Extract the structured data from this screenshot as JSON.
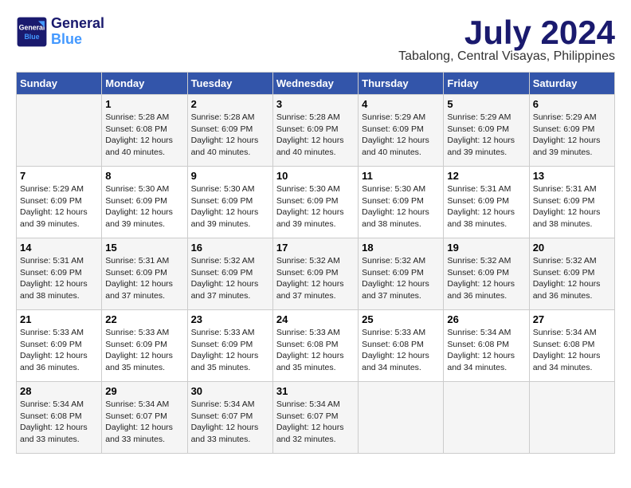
{
  "logo": {
    "line1": "General",
    "line2": "Blue"
  },
  "title": "July 2024",
  "location": "Tabalong, Central Visayas, Philippines",
  "weekdays": [
    "Sunday",
    "Monday",
    "Tuesday",
    "Wednesday",
    "Thursday",
    "Friday",
    "Saturday"
  ],
  "weeks": [
    [
      {
        "day": "",
        "info": ""
      },
      {
        "day": "1",
        "info": "Sunrise: 5:28 AM\nSunset: 6:08 PM\nDaylight: 12 hours\nand 40 minutes."
      },
      {
        "day": "2",
        "info": "Sunrise: 5:28 AM\nSunset: 6:09 PM\nDaylight: 12 hours\nand 40 minutes."
      },
      {
        "day": "3",
        "info": "Sunrise: 5:28 AM\nSunset: 6:09 PM\nDaylight: 12 hours\nand 40 minutes."
      },
      {
        "day": "4",
        "info": "Sunrise: 5:29 AM\nSunset: 6:09 PM\nDaylight: 12 hours\nand 40 minutes."
      },
      {
        "day": "5",
        "info": "Sunrise: 5:29 AM\nSunset: 6:09 PM\nDaylight: 12 hours\nand 39 minutes."
      },
      {
        "day": "6",
        "info": "Sunrise: 5:29 AM\nSunset: 6:09 PM\nDaylight: 12 hours\nand 39 minutes."
      }
    ],
    [
      {
        "day": "7",
        "info": "Sunrise: 5:29 AM\nSunset: 6:09 PM\nDaylight: 12 hours\nand 39 minutes."
      },
      {
        "day": "8",
        "info": "Sunrise: 5:30 AM\nSunset: 6:09 PM\nDaylight: 12 hours\nand 39 minutes."
      },
      {
        "day": "9",
        "info": "Sunrise: 5:30 AM\nSunset: 6:09 PM\nDaylight: 12 hours\nand 39 minutes."
      },
      {
        "day": "10",
        "info": "Sunrise: 5:30 AM\nSunset: 6:09 PM\nDaylight: 12 hours\nand 39 minutes."
      },
      {
        "day": "11",
        "info": "Sunrise: 5:30 AM\nSunset: 6:09 PM\nDaylight: 12 hours\nand 38 minutes."
      },
      {
        "day": "12",
        "info": "Sunrise: 5:31 AM\nSunset: 6:09 PM\nDaylight: 12 hours\nand 38 minutes."
      },
      {
        "day": "13",
        "info": "Sunrise: 5:31 AM\nSunset: 6:09 PM\nDaylight: 12 hours\nand 38 minutes."
      }
    ],
    [
      {
        "day": "14",
        "info": "Sunrise: 5:31 AM\nSunset: 6:09 PM\nDaylight: 12 hours\nand 38 minutes."
      },
      {
        "day": "15",
        "info": "Sunrise: 5:31 AM\nSunset: 6:09 PM\nDaylight: 12 hours\nand 37 minutes."
      },
      {
        "day": "16",
        "info": "Sunrise: 5:32 AM\nSunset: 6:09 PM\nDaylight: 12 hours\nand 37 minutes."
      },
      {
        "day": "17",
        "info": "Sunrise: 5:32 AM\nSunset: 6:09 PM\nDaylight: 12 hours\nand 37 minutes."
      },
      {
        "day": "18",
        "info": "Sunrise: 5:32 AM\nSunset: 6:09 PM\nDaylight: 12 hours\nand 37 minutes."
      },
      {
        "day": "19",
        "info": "Sunrise: 5:32 AM\nSunset: 6:09 PM\nDaylight: 12 hours\nand 36 minutes."
      },
      {
        "day": "20",
        "info": "Sunrise: 5:32 AM\nSunset: 6:09 PM\nDaylight: 12 hours\nand 36 minutes."
      }
    ],
    [
      {
        "day": "21",
        "info": "Sunrise: 5:33 AM\nSunset: 6:09 PM\nDaylight: 12 hours\nand 36 minutes."
      },
      {
        "day": "22",
        "info": "Sunrise: 5:33 AM\nSunset: 6:09 PM\nDaylight: 12 hours\nand 35 minutes."
      },
      {
        "day": "23",
        "info": "Sunrise: 5:33 AM\nSunset: 6:09 PM\nDaylight: 12 hours\nand 35 minutes."
      },
      {
        "day": "24",
        "info": "Sunrise: 5:33 AM\nSunset: 6:08 PM\nDaylight: 12 hours\nand 35 minutes."
      },
      {
        "day": "25",
        "info": "Sunrise: 5:33 AM\nSunset: 6:08 PM\nDaylight: 12 hours\nand 34 minutes."
      },
      {
        "day": "26",
        "info": "Sunrise: 5:34 AM\nSunset: 6:08 PM\nDaylight: 12 hours\nand 34 minutes."
      },
      {
        "day": "27",
        "info": "Sunrise: 5:34 AM\nSunset: 6:08 PM\nDaylight: 12 hours\nand 34 minutes."
      }
    ],
    [
      {
        "day": "28",
        "info": "Sunrise: 5:34 AM\nSunset: 6:08 PM\nDaylight: 12 hours\nand 33 minutes."
      },
      {
        "day": "29",
        "info": "Sunrise: 5:34 AM\nSunset: 6:07 PM\nDaylight: 12 hours\nand 33 minutes."
      },
      {
        "day": "30",
        "info": "Sunrise: 5:34 AM\nSunset: 6:07 PM\nDaylight: 12 hours\nand 33 minutes."
      },
      {
        "day": "31",
        "info": "Sunrise: 5:34 AM\nSunset: 6:07 PM\nDaylight: 12 hours\nand 32 minutes."
      },
      {
        "day": "",
        "info": ""
      },
      {
        "day": "",
        "info": ""
      },
      {
        "day": "",
        "info": ""
      }
    ]
  ]
}
